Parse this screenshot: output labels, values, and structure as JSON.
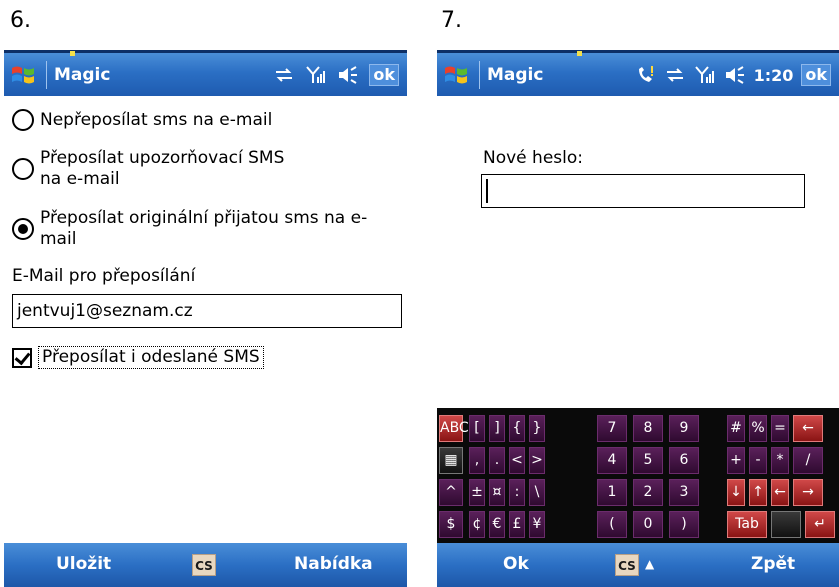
{
  "figures": {
    "left_number": "6.",
    "right_number": "7."
  },
  "screen6": {
    "titlebar": {
      "title": "Magic",
      "ok": "ok"
    },
    "options": [
      {
        "line1": "Nepřeposílat sms na e-mail",
        "line2": "",
        "checked": false
      },
      {
        "line1": "Přeposílat upozorňovací SMS",
        "line2": "na e-mail",
        "checked": false
      },
      {
        "line1": "Přeposílat originální přijatou sms na e-",
        "line2": "mail",
        "checked": true
      }
    ],
    "email_label": "E-Mail pro přeposílání",
    "email_value": "jentvuj1@seznam.cz",
    "checkbox_label": "Přeposílat i odeslané SMS",
    "checkbox_checked": true,
    "menubar": {
      "left": "Uložit",
      "center": "CS",
      "right": "Nabídka"
    }
  },
  "screen7": {
    "titlebar": {
      "title": "Magic",
      "time": "1:20",
      "ok": "ok"
    },
    "password_label": "Nové heslo:",
    "password_value": "",
    "keyboard": {
      "rows": [
        [
          "ABC",
          "[",
          "]",
          "{",
          "}",
          "7",
          "8",
          "9",
          "#",
          "%",
          "=",
          "←"
        ],
        [
          "▦",
          ",",
          ".",
          "<",
          ">",
          "4",
          "5",
          "6",
          "+",
          "-",
          "*",
          "/"
        ],
        [
          "^",
          "±",
          "¤",
          ":",
          "\\",
          "1",
          "2",
          "3",
          "↓",
          "↑",
          "←",
          "→"
        ],
        [
          "$",
          "¢",
          "€",
          "£",
          "¥",
          "(",
          "0",
          ")",
          "Tab",
          "",
          "↵"
        ]
      ]
    },
    "menubar": {
      "left": "Ok",
      "center": "CS",
      "center_arrow": "▲",
      "right": "Zpět"
    }
  },
  "colors": {
    "titlebar": "#2b6fc4",
    "key_purple": "#5a205a",
    "key_red": "#d04848"
  }
}
